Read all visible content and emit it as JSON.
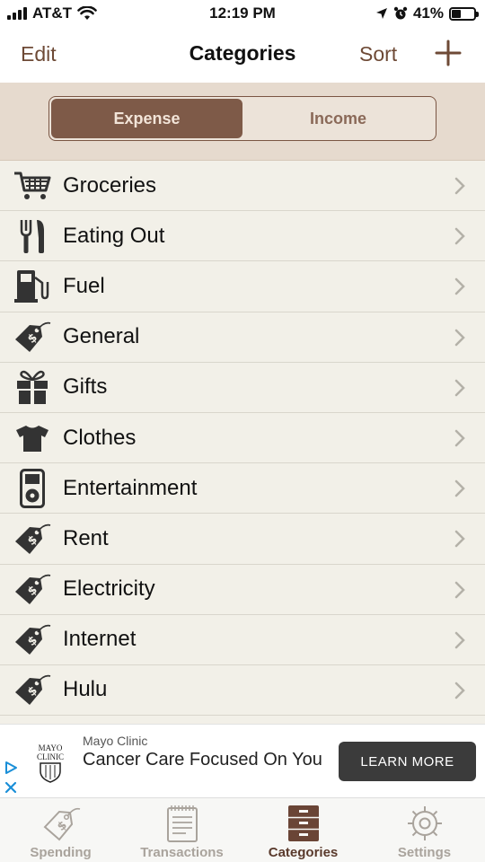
{
  "status_bar": {
    "carrier": "AT&T",
    "time": "12:19 PM",
    "battery_percent": "41%",
    "battery_level": 0.41
  },
  "nav": {
    "edit_label": "Edit",
    "title": "Categories",
    "sort_label": "Sort",
    "add_icon": "plus-icon"
  },
  "segments": {
    "expense_label": "Expense",
    "income_label": "Income",
    "selected": "Expense"
  },
  "categories": [
    {
      "label": "Groceries",
      "icon": "cart-icon"
    },
    {
      "label": "Eating Out",
      "icon": "fork-knife-icon"
    },
    {
      "label": "Fuel",
      "icon": "fuel-pump-icon"
    },
    {
      "label": "General",
      "icon": "price-tag-icon"
    },
    {
      "label": "Gifts",
      "icon": "gift-icon"
    },
    {
      "label": "Clothes",
      "icon": "shirt-icon"
    },
    {
      "label": "Entertainment",
      "icon": "ipod-icon"
    },
    {
      "label": "Rent",
      "icon": "price-tag-icon"
    },
    {
      "label": "Electricity",
      "icon": "price-tag-icon"
    },
    {
      "label": "Internet",
      "icon": "price-tag-icon"
    },
    {
      "label": "Hulu",
      "icon": "price-tag-icon"
    }
  ],
  "ad": {
    "logo_text_line1": "MAYO",
    "logo_text_line2": "CLINIC",
    "sponsor": "Mayo Clinic",
    "headline": "Cancer Care Focused On You",
    "button_label": "LEARN MORE"
  },
  "tabs": [
    {
      "label": "Spending",
      "icon": "price-tag-icon",
      "active": false
    },
    {
      "label": "Transactions",
      "icon": "document-icon",
      "active": false
    },
    {
      "label": "Categories",
      "icon": "drawer-cabinet-icon",
      "active": true
    },
    {
      "label": "Settings",
      "icon": "gear-icon",
      "active": false
    }
  ],
  "colors": {
    "accent": "#6e4a36",
    "segment_active": "#7e5a48",
    "list_background": "#f2f0e8",
    "icon_dark": "#333333"
  }
}
